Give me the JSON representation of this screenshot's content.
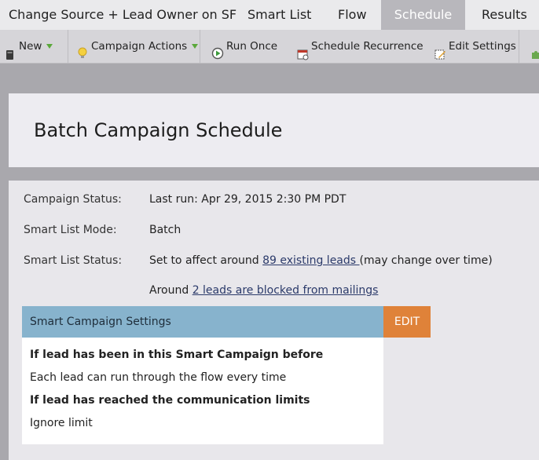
{
  "tabs": [
    {
      "label": "Change Source + Lead Owner on SF"
    },
    {
      "label": "Smart List"
    },
    {
      "label": "Flow"
    },
    {
      "label": "Schedule"
    },
    {
      "label": "Results"
    }
  ],
  "toolbar": {
    "new_label": "New",
    "campaign_actions_label": "Campaign Actions",
    "run_once_label": "Run Once",
    "schedule_recurrence_label": "Schedule Recurrence",
    "edit_settings_label": "Edit Settings"
  },
  "page_title": "Batch Campaign Schedule",
  "details": {
    "campaign_status": {
      "label": "Campaign Status:",
      "value": "Last run: Apr 29, 2015 2:30 PM PDT"
    },
    "smart_list_mode": {
      "label": "Smart List Mode:",
      "value": "Batch"
    },
    "smart_list_status": {
      "label": "Smart List Status:",
      "prefix": "Set to affect around ",
      "link": "89 existing leads ",
      "suffix": "(may change over time)"
    },
    "blocked": {
      "prefix": "Around ",
      "link": "2 leads are blocked from mailings"
    }
  },
  "settings": {
    "header": "Smart Campaign Settings",
    "edit_label": "EDIT",
    "q1": "If lead has been in this Smart Campaign before",
    "a1": "Each lead can run through the flow every time",
    "q2": "If lead has reached the communication limits",
    "a2": "Ignore limit"
  },
  "colors": {
    "active_tab": "#b8b7bc",
    "settings_header": "#87b3cd",
    "edit_button": "#df8239",
    "link": "#2b3a6a"
  }
}
